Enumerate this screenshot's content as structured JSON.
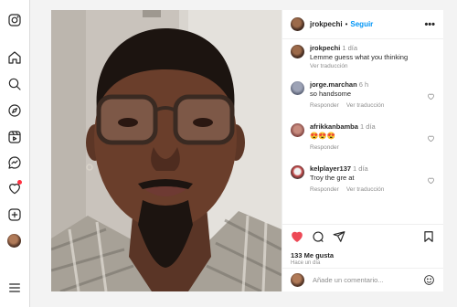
{
  "nav": {
    "icons": [
      "instagram-icon",
      "home-icon",
      "search-icon",
      "explore-icon",
      "reels-icon",
      "messages-icon",
      "notifications-icon",
      "create-icon",
      "profile-avatar",
      "menu-icon"
    ]
  },
  "post": {
    "author": "jrokpechi",
    "separator": "•",
    "follow_label": "Seguir",
    "more_label": "•••",
    "caption": {
      "user": "jrokpechi",
      "time": "1 día",
      "text": "Lemme guess what you thinking",
      "translate": "Ver traducción"
    },
    "comments": [
      {
        "user": "jorge.marchan",
        "time": "6 h",
        "text": "so handsome",
        "reply": "Responder",
        "translate": "Ver traducción"
      },
      {
        "user": "afrikkanbamba",
        "time": "1 día",
        "text": "😍😍😍",
        "reply": "Responder"
      },
      {
        "user": "kelplayer137",
        "time": "1 día",
        "text": "Troy the gre at",
        "reply": "Responder",
        "translate": "Ver traducción"
      }
    ],
    "likes": "133 Me gusta",
    "posted": "Hace un día",
    "add_comment_placeholder": "Añade un comentario..."
  },
  "colors": {
    "accent": "#0095f6",
    "like_red": "#ed4956",
    "muted": "#8e8e8e"
  }
}
